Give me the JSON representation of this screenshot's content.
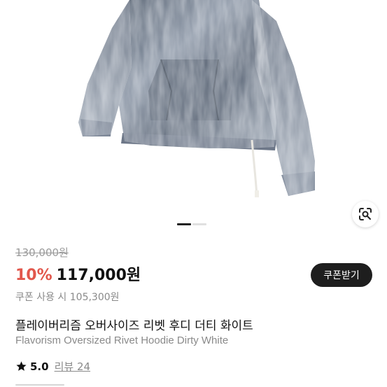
{
  "product": {
    "original_price": "130,000원",
    "discount_rate": "10%",
    "sale_price": "117,000원",
    "coupon_button": "쿠폰받기",
    "coupon_price": "쿠폰 사용 시 105,300원",
    "title_ko": "플레이버리즘 오버사이즈 리벳 후디 더티 화이트",
    "title_en": "Flavorism Oversized Rivet Hoodie Dirty White",
    "rating": "5.0",
    "review_label": "리뷰 24"
  },
  "gallery": {
    "total_images": 2,
    "active_index": 0
  },
  "icons": {
    "lens": "lens-search-icon",
    "star": "star-icon"
  },
  "colors": {
    "discount": "#e2574c",
    "coupon_button_bg": "#1e1e1e",
    "muted_text": "#8a8a8a"
  }
}
